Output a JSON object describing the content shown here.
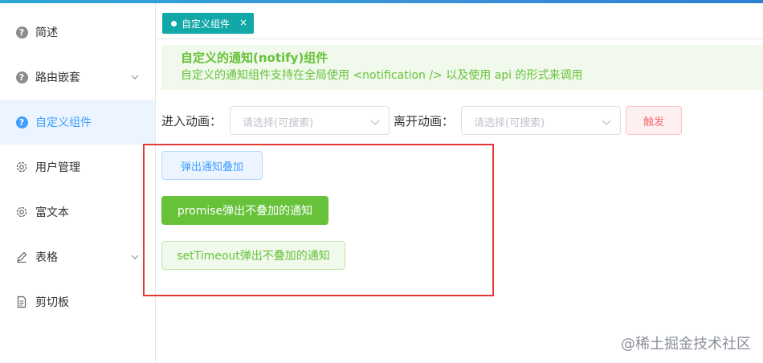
{
  "sidebar": {
    "items": [
      {
        "label": "简述",
        "icon": "question-circle-icon",
        "has_chevron": false,
        "active": false
      },
      {
        "label": "路由嵌套",
        "icon": "question-circle-icon",
        "has_chevron": true,
        "active": false
      },
      {
        "label": "自定义组件",
        "icon": "question-circle-icon",
        "has_chevron": false,
        "active": true
      },
      {
        "label": "用户管理",
        "icon": "gear-icon",
        "has_chevron": false,
        "active": false
      },
      {
        "label": "富文本",
        "icon": "gear-icon",
        "has_chevron": false,
        "active": false
      },
      {
        "label": "表格",
        "icon": "pencil-icon",
        "has_chevron": true,
        "active": false
      },
      {
        "label": "剪切板",
        "icon": "document-icon",
        "has_chevron": false,
        "active": false
      }
    ]
  },
  "tabs": [
    {
      "label": "自定义组件",
      "close": "×"
    }
  ],
  "alert": {
    "title": "自定义的通知(notify)组件",
    "description": "自定义的通知组件支持在全局使用 <notification /> 以及使用 api 的形式来调用"
  },
  "form": {
    "enter_label": "进入动画：",
    "enter_placeholder": "请选择(可搜索)",
    "leave_label": "离开动画：",
    "leave_placeholder": "请选择(可搜索)",
    "trigger_label": "触发"
  },
  "buttons": {
    "stack": "弹出通知叠加",
    "promise": "promise弹出不叠加的通知",
    "timeout": "setTimeout弹出不叠加的通知"
  },
  "watermark": "@稀土掘金技术社区",
  "colors": {
    "primary": "#409eff",
    "success": "#67c23a",
    "danger": "#f56c6c",
    "tab": "#13a8a8",
    "highlight_box": "#e53935"
  }
}
